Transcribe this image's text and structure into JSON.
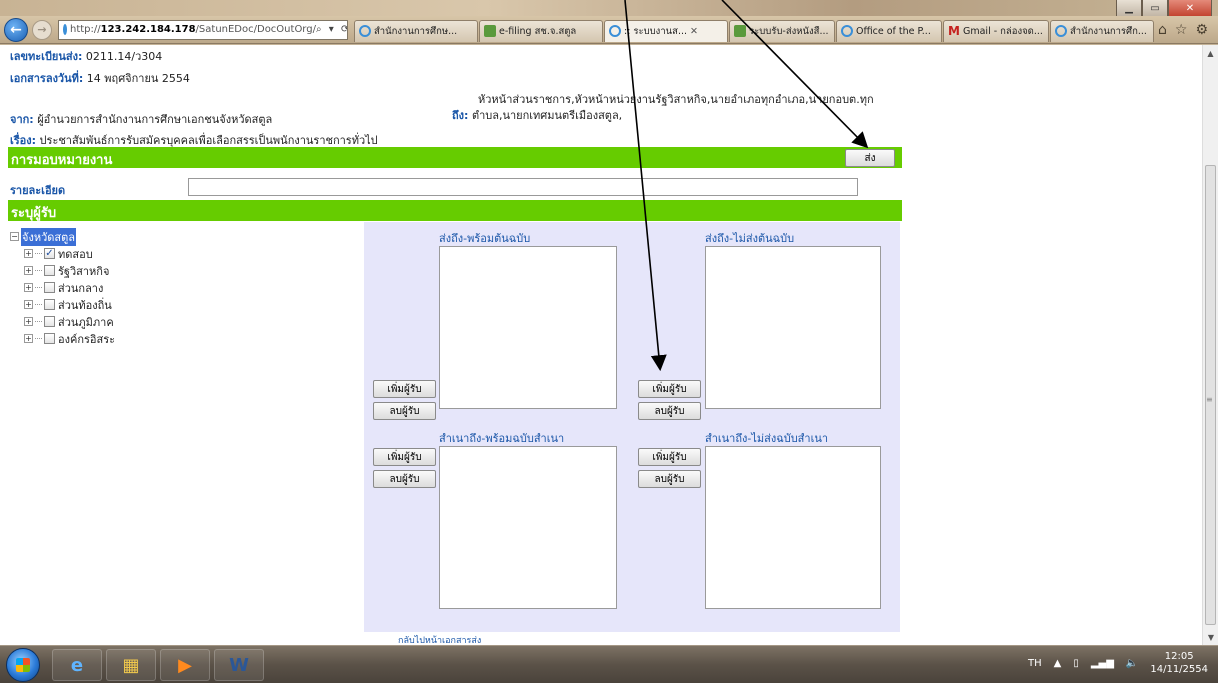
{
  "browser": {
    "url_prefix": "http://",
    "url_domain": "123.242.184.178",
    "url_path": "/SatunEDoc/DocOutOrg/",
    "addr_tools": "⌕ ▾ ⟳ ✕",
    "tabs": [
      {
        "label": "สำนักงานการศึกษ...",
        "icon": "ie-icon",
        "active": false
      },
      {
        "label": "e-filing สช.จ.สตูล",
        "icon": "mail-icon",
        "active": false
      },
      {
        "label": ":: ระบบงานส...",
        "icon": "ie-icon",
        "active": true
      },
      {
        "label": "ระบบรับ-ส่งหนังสื...",
        "icon": "mail-icon",
        "active": false
      },
      {
        "label": "Office of the P...",
        "icon": "ie-icon",
        "active": false
      },
      {
        "label": "Gmail - กล่องจด...",
        "icon": "gmail-icon",
        "active": false
      },
      {
        "label": "สำนักงานการศึก...",
        "icon": "ie-icon",
        "active": false
      }
    ]
  },
  "doc": {
    "reg_label": "เลขทะเบียนส่ง:",
    "reg_value": "0211.14/ว304",
    "date_label": "เอกสารลงวันที่:",
    "date_value": "14 พฤศจิกายน  2554",
    "from_label": "จาก:",
    "from_value": "ผู้อำนวยการสำนักงานการศึกษาเอกชนจังหวัดสตูล",
    "to_line1": "หัวหน้าส่วนราชการ,หัวหน้าหน่วยงานรัฐวิสาหกิจ,นายอำเภอทุกอำเภอ,นายกอบต.ทุก",
    "to_label": "ถึง:",
    "to_line2": "ตำบล,นายกเทศมนตรีเมืองสตูล,",
    "subject_label": "เรื่อง:",
    "subject_value": "ประชาสัมพันธ์การรับสมัครบุคคลเพื่อเลือกสรรเป็นพนักงานราชการทั่วไป"
  },
  "assign": {
    "title": "การมอบหมายงาน",
    "send_label": "ส่ง",
    "detail_label": "รายละเอียด",
    "detail_value": ""
  },
  "recipients": {
    "title": "ระบุผู้รับ",
    "tree_root": "จังหวัดสตูล",
    "tree_items": [
      {
        "label": "ทดสอบ",
        "checked": true
      },
      {
        "label": "รัฐวิสาหกิจ",
        "checked": false
      },
      {
        "label": "ส่วนกลาง",
        "checked": false
      },
      {
        "label": "ส่วนท้องถิ่น",
        "checked": false
      },
      {
        "label": "ส่วนภูมิภาค",
        "checked": false
      },
      {
        "label": "องค์กรอิสระ",
        "checked": false
      }
    ]
  },
  "panel": {
    "col1_head": "ส่งถึง-พร้อมต้นฉบับ",
    "col2_head": "ส่งถึง-ไม่ส่งต้นฉบับ",
    "col3_head": "สำเนาถึง-พร้อมฉบับสำเนา",
    "col4_head": "สำเนาถึง-ไม่ส่งฉบับสำเนา",
    "add_label": "เพิ่มผู้รับ",
    "remove_label": "ลบผู้รับ",
    "back_link": "กลับไปหน้าเอกสารส่ง"
  },
  "taskbar": {
    "lang": "TH",
    "time": "12:05",
    "date": "14/11/2554"
  },
  "colors": {
    "green_bar": "#66cc00",
    "panel_bg": "#e6e6fa",
    "label_blue": "#1a56a8"
  }
}
